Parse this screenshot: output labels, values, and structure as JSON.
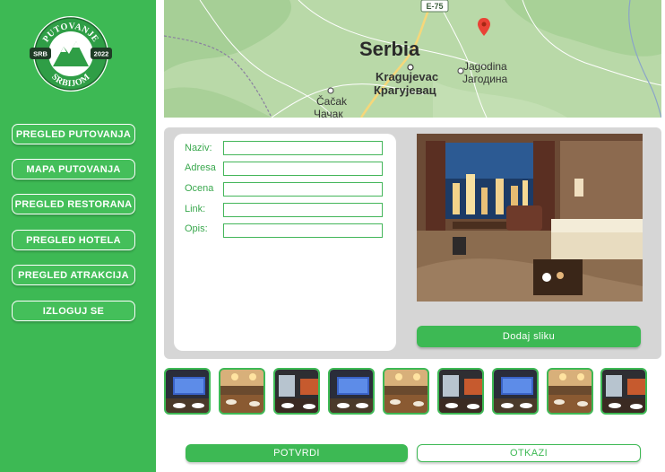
{
  "logo": {
    "top_text": "PUTOVANJE",
    "bottom_text": "SRBIJOM",
    "left_tag": "SRB",
    "right_tag": "2022"
  },
  "sidebar": {
    "items": [
      {
        "label": "PREGLED PUTOVANJA"
      },
      {
        "label": "MAPA PUTOVANJA"
      },
      {
        "label": "PREGLED RESTORANA"
      },
      {
        "label": "PREGLED HOTELA"
      },
      {
        "label": "PREGLED ATRAKCIJA"
      },
      {
        "label": "IZLOGUJ SE"
      }
    ]
  },
  "map": {
    "country": "Serbia",
    "road_label": "E-75",
    "cities": [
      {
        "latin": "Kragujevac",
        "cyrillic": "Крагујевац"
      },
      {
        "latin": "Jagodina",
        "cyrillic": "Јагодина"
      },
      {
        "latin": "Čačak",
        "cyrillic": "Чачак"
      }
    ]
  },
  "form": {
    "fields": [
      {
        "label": "Naziv:",
        "value": ""
      },
      {
        "label": "Adresa",
        "value": ""
      },
      {
        "label": "Ocena",
        "value": ""
      },
      {
        "label": "Link:",
        "value": ""
      },
      {
        "label": "Opis:",
        "value": ""
      }
    ]
  },
  "photo": {
    "add_button": "Dodaj sliku"
  },
  "thumbnails": [
    {
      "name": "restaurant-photo"
    },
    {
      "name": "restaurant-photo"
    },
    {
      "name": "restaurant-photo"
    },
    {
      "name": "restaurant-photo"
    },
    {
      "name": "restaurant-photo"
    },
    {
      "name": "restaurant-photo"
    },
    {
      "name": "restaurant-photo"
    },
    {
      "name": "restaurant-photo"
    },
    {
      "name": "restaurant-photo"
    }
  ],
  "actions": {
    "confirm": "POTVRDI",
    "cancel": "OTKAZI"
  },
  "colors": {
    "accent": "#3db954",
    "panel": "#d6d6d6"
  }
}
